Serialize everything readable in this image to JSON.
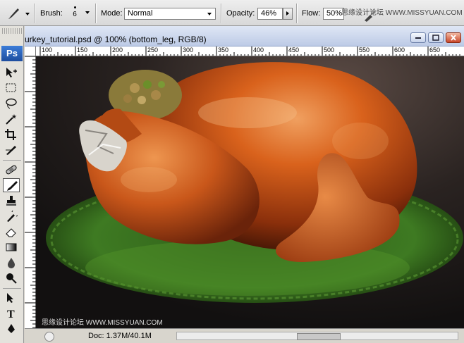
{
  "options_bar": {
    "brush_label": "Brush:",
    "brush_size": "6",
    "mode_label": "Mode:",
    "mode_value": "Normal",
    "opacity_label": "Opacity:",
    "opacity_value": "46%",
    "flow_label": "Flow:",
    "flow_value": "50%",
    "watermark": "思缘设计论坛 WWW.MISSYUAN.COM"
  },
  "toolbox": {
    "logo": "Ps",
    "tools": [
      "move-tool",
      "marquee-tool",
      "lasso-tool",
      "magic-wand-tool",
      "crop-tool",
      "slice-tool",
      "healing-brush-tool",
      "brush-tool",
      "clone-stamp-tool",
      "history-brush-tool",
      "eraser-tool",
      "gradient-tool",
      "blur-tool",
      "dodge-tool",
      "path-selection-tool",
      "type-tool",
      "pen-tool"
    ],
    "active_tool": "brush-tool"
  },
  "document": {
    "title": "urkey_tutorial.psd @ 100% (bottom_leg, RGB/8)",
    "ruler_ticks": [
      "100",
      "150",
      "200",
      "250",
      "300",
      "350",
      "400",
      "450",
      "500",
      "550",
      "600",
      "650"
    ],
    "status_doc": "Doc: 1.37M/40.1M",
    "canvas_watermark": "思缘设计论坛 WWW.MISSYUAN.COM"
  }
}
